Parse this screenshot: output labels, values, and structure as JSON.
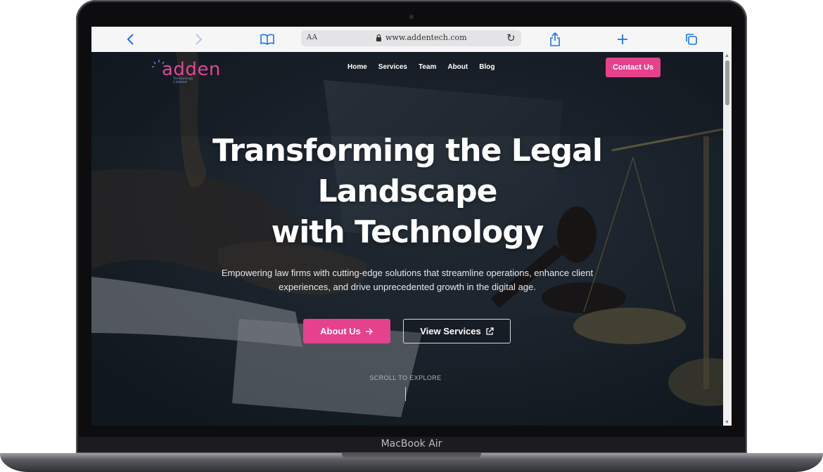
{
  "device": {
    "model_label": "MacBook Air"
  },
  "browser": {
    "text_size_label": "AA",
    "url": "www.addentech.com",
    "icons": [
      "chevron-left-icon",
      "chevron-right-icon",
      "book-icon",
      "lock-icon",
      "reload-icon",
      "share-icon",
      "plus-icon",
      "tabs-icon"
    ]
  },
  "site": {
    "logo": {
      "word": "adden",
      "tagline_line1": "Technology",
      "tagline_line2": "Limited",
      "color": "#e14596"
    },
    "nav": [
      "Home",
      "Services",
      "Team",
      "About",
      "Blog"
    ],
    "contact_label": "Contact Us",
    "accent_color": "#e6418d"
  },
  "hero": {
    "title_line1": "Transforming the Legal",
    "title_line2": "Landscape",
    "title_line3": "with Technology",
    "subtitle": "Empowering law firms with cutting-edge solutions that streamline operations, enhance client experiences, and drive unprecedented growth in the digital age.",
    "primary_button": "About Us",
    "secondary_button": "View Services",
    "scroll_hint": "SCROLL TO EXPLORE"
  }
}
